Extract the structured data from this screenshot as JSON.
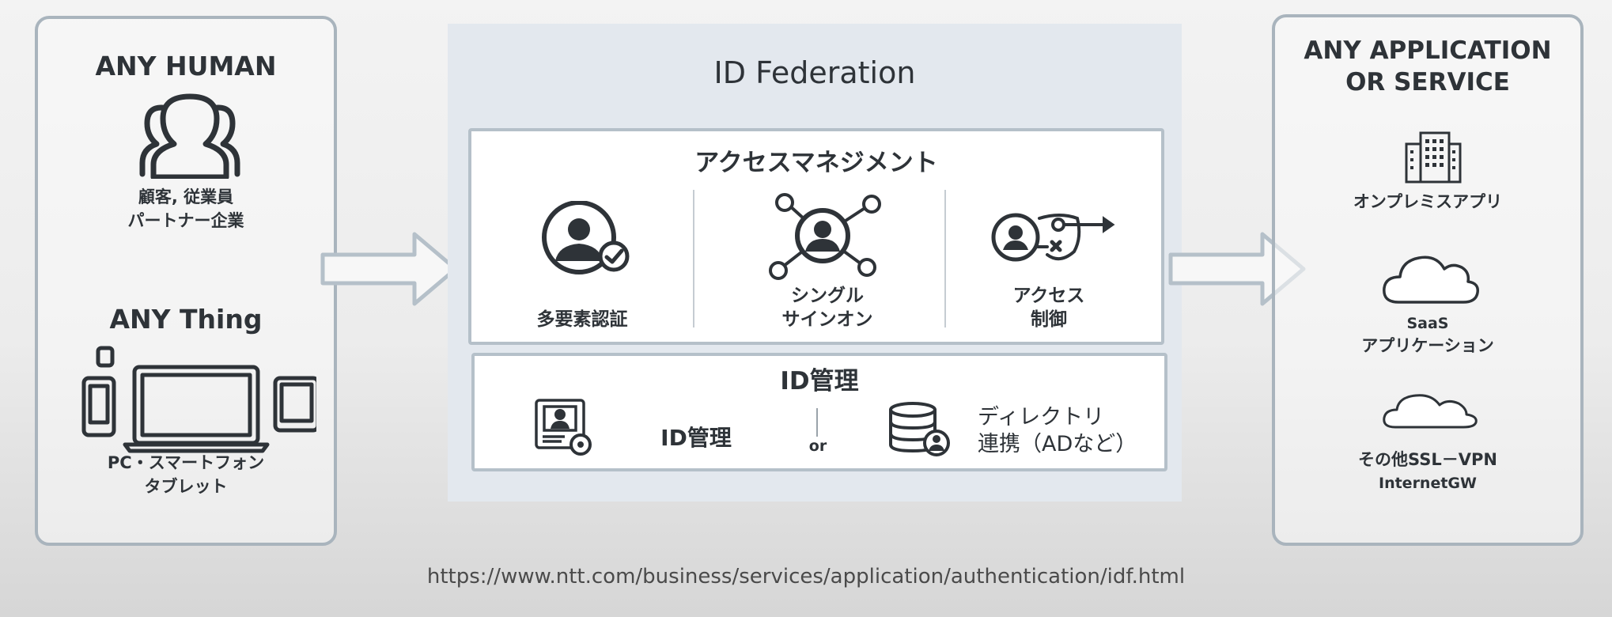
{
  "left": {
    "human_title": "ANY HUMAN",
    "human_sub1": "顧客, 従業員",
    "human_sub2": "パートナー企業",
    "thing_title": "ANY Thing",
    "thing_sub1": "PC・スマートフォン",
    "thing_sub2": "タブレット"
  },
  "center": {
    "title": "ID Federation",
    "access_title": "アクセスマネジメント",
    "mfa_label": "多要素認証",
    "sso_label1": "シングル",
    "sso_label2": "サインオン",
    "access_label1": "アクセス",
    "access_label2": "制御",
    "idm_title": "ID管理",
    "idm_label": "ID管理",
    "or_label": "or",
    "dir_label1": "ディレクトリ",
    "dir_label2": "連携（ADなど）"
  },
  "right": {
    "title1": "ANY APPLICATION",
    "title2": "OR SERVICE",
    "onprem_label": "オンプレミスアプリ",
    "saas_label1": "SaaS",
    "saas_label2": "アプリケーション",
    "other_label1": "その他SSL－VPN",
    "other_label2": "InternetGW"
  },
  "footer": {
    "url": "https://www.ntt.com/business/services/application/authentication/idf.html"
  }
}
